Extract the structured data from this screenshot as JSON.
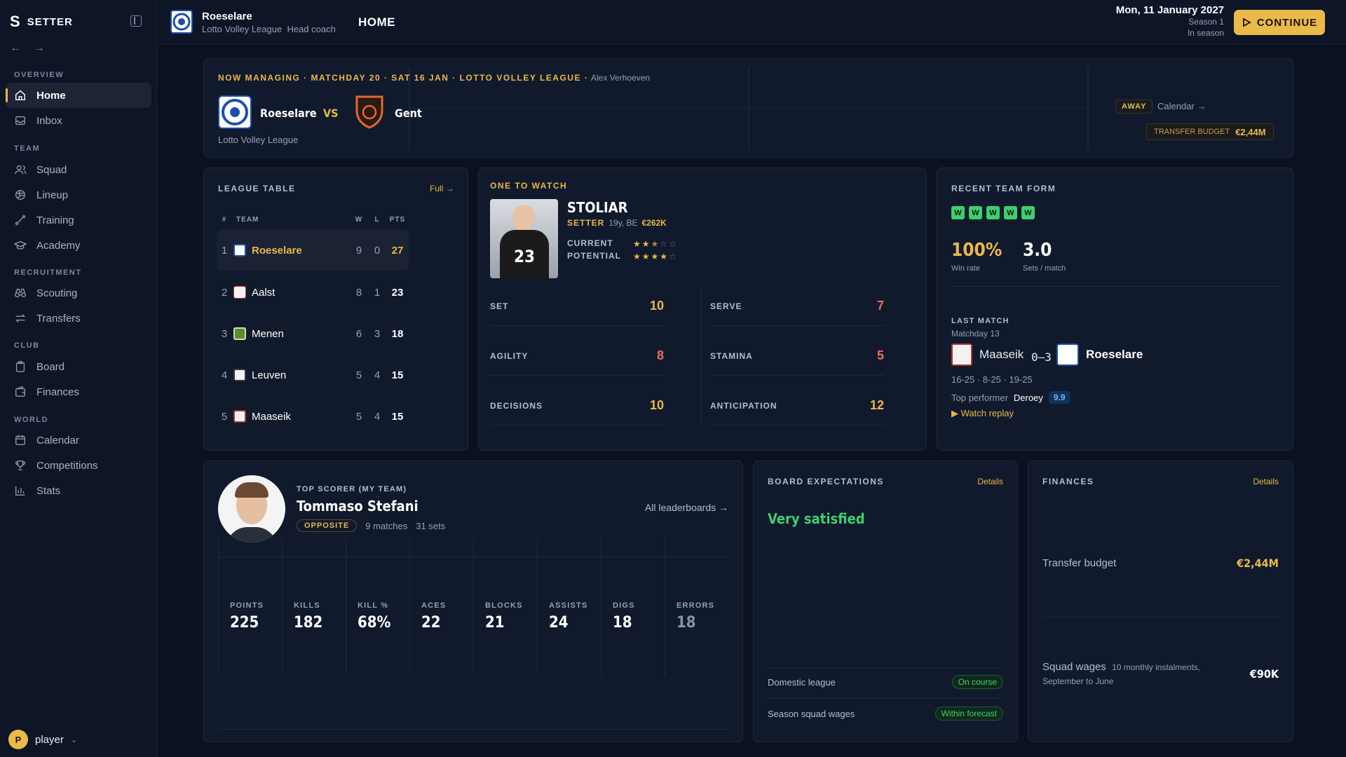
{
  "sidebar": {
    "brand_mark": "S",
    "brand_name": "SETTER",
    "sections": {
      "overview": "OVERVIEW",
      "team": "TEAM",
      "recruitment": "RECRUITMENT",
      "club": "CLUB",
      "world": "WORLD"
    },
    "items": {
      "home": "Home",
      "inbox": "Inbox",
      "squad": "Squad",
      "lineup": "Lineup",
      "training": "Training",
      "academy": "Academy",
      "scouting": "Scouting",
      "transfers": "Transfers",
      "board": "Board",
      "finances": "Finances",
      "calendar": "Calendar",
      "competitions": "Competitions",
      "stats": "Stats"
    },
    "user": {
      "initial": "P",
      "name": "player"
    }
  },
  "topbar": {
    "club_name": "Roeselare",
    "league": "Lotto Volley League",
    "role": "Head coach",
    "page_title": "HOME",
    "date": "Mon, 11 January 2027",
    "season": "Season 1",
    "season_state": "In season",
    "continue_label": "CONTINUE"
  },
  "match": {
    "header": "NOW MANAGING · MATCHDAY 20 · SAT 16 JAN · LOTTO VOLLEY LEAGUE ·",
    "coach": "Alex Verhoeven",
    "home_team": "Roeselare",
    "vs": "VS",
    "away_team": "Gent",
    "competition": "Lotto Volley League",
    "venue_badge": "AWAY",
    "calendar_link": "Calendar →",
    "budget_label": "TRANSFER BUDGET",
    "budget_value": "€2,44M"
  },
  "league_table": {
    "title": "LEAGUE TABLE",
    "full_link": "Full →",
    "headers": {
      "pos": "#",
      "team": "TEAM",
      "w": "W",
      "l": "L",
      "pts": "PTS"
    },
    "rows": [
      {
        "pos": "1",
        "team": "Roeselare",
        "w": "9",
        "l": "0",
        "pts": "27"
      },
      {
        "pos": "2",
        "team": "Aalst",
        "w": "8",
        "l": "1",
        "pts": "23"
      },
      {
        "pos": "3",
        "team": "Menen",
        "w": "6",
        "l": "3",
        "pts": "18"
      },
      {
        "pos": "4",
        "team": "Leuven",
        "w": "5",
        "l": "4",
        "pts": "15"
      },
      {
        "pos": "5",
        "team": "Maaseik",
        "w": "5",
        "l": "4",
        "pts": "15"
      }
    ]
  },
  "one_to_watch": {
    "title": "ONE TO WATCH",
    "name": "STOLIAR",
    "position": "SETTER",
    "meta": "19y, BE",
    "value": "€262K",
    "current_label": "CURRENT",
    "current_stars": 2.5,
    "potential_label": "POTENTIAL",
    "potential_stars": 4,
    "attributes": [
      {
        "label": "SET",
        "value": "10"
      },
      {
        "label": "SERVE",
        "value": "7"
      },
      {
        "label": "AGILITY",
        "value": "8"
      },
      {
        "label": "STAMINA",
        "value": "5"
      },
      {
        "label": "DECISIONS",
        "value": "10"
      },
      {
        "label": "ANTICIPATION",
        "value": "12"
      }
    ],
    "jersey_number": "23"
  },
  "recent_form": {
    "title": "RECENT TEAM FORM",
    "results": [
      "W",
      "W",
      "W",
      "W",
      "W"
    ],
    "win_rate": "100%",
    "win_rate_label": "Win rate",
    "sets_per_match": "3.0",
    "sets_label": "Sets / match",
    "last_match_title": "LAST MATCH",
    "last_match_day": "Matchday 13",
    "last_home": "Maaseik",
    "last_score": "0–3",
    "last_away": "Roeselare",
    "set_scores": "16-25 · 8-25 · 19-25",
    "top_performer_label": "Top performer",
    "top_performer_name": "Deroey",
    "top_performer_rating": "9.9",
    "replay_link": "▶ Watch replay"
  },
  "top_scorer": {
    "title": "TOP SCORER (MY TEAM)",
    "name": "Tommaso Stefani",
    "position": "OPPOSITE",
    "matches": "9 matches",
    "sets": "31 sets",
    "leaderboards_link": "All leaderboards →",
    "stats": [
      {
        "label": "POINTS",
        "value": "225"
      },
      {
        "label": "KILLS",
        "value": "182"
      },
      {
        "label": "KILL %",
        "value": "68%"
      },
      {
        "label": "ACES",
        "value": "22"
      },
      {
        "label": "BLOCKS",
        "value": "21"
      },
      {
        "label": "ASSISTS",
        "value": "24"
      },
      {
        "label": "DIGS",
        "value": "18"
      },
      {
        "label": "ERRORS",
        "value": "18"
      }
    ]
  },
  "board": {
    "title": "BOARD EXPECTATIONS",
    "details": "Details",
    "status": "Very satisfied",
    "rows": [
      {
        "label": "Domestic league",
        "value": "On course"
      },
      {
        "label": "Season squad wages",
        "value": "Within forecast"
      }
    ]
  },
  "finances": {
    "title": "FINANCES",
    "details": "Details",
    "transfer_label": "Transfer budget",
    "transfer_value": "€2,44M",
    "wages_label": "Squad wages",
    "wages_note": "10 monthly instalments,",
    "wages_note2": "September to June",
    "wages_value": "€90K"
  },
  "colors": {
    "accent": "#e9b949",
    "win": "#3ecf6e",
    "bg": "#0b1120",
    "card": "#111a2c",
    "error_text": "#ef6b5a"
  }
}
